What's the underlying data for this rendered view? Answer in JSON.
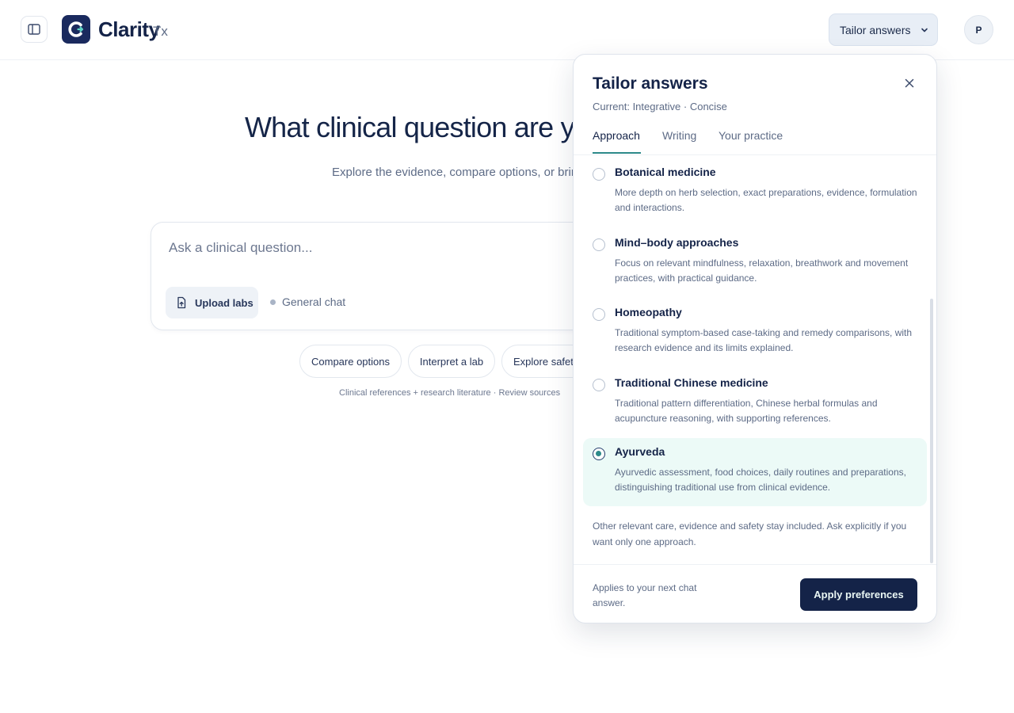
{
  "app": {
    "brand": "Clarity",
    "brand_suffix": "Tx"
  },
  "header": {
    "tailor_label": "Tailor answers",
    "avatar_initial": "P"
  },
  "main": {
    "headline": "What clinical question are yo",
    "subtitle": "Explore the evidence, compare options, or brin",
    "ask_placeholder": "Ask a clinical question...",
    "upload_label": "Upload labs",
    "mode_label": "General chat",
    "chips": [
      "Compare options",
      "Interpret a lab",
      "Explore safet"
    ],
    "footnote": "Clinical references + research literature · Review sources"
  },
  "popover": {
    "title": "Tailor answers",
    "current": "Current: Integrative · Concise",
    "tabs": [
      "Approach",
      "Writing",
      "Your practice"
    ],
    "active_tab": "Approach",
    "options": [
      {
        "title": "Botanical medicine",
        "desc": "More depth on herb selection, exact preparations, evidence, formulation and interactions.",
        "selected": false
      },
      {
        "title": "Mind–body approaches",
        "desc": "Focus on relevant mindfulness, relaxation, breathwork and movement practices, with practical guidance.",
        "selected": false
      },
      {
        "title": "Homeopathy",
        "desc": "Traditional symptom-based case-taking and remedy comparisons, with research evidence and its limits explained.",
        "selected": false
      },
      {
        "title": "Traditional Chinese medicine",
        "desc": "Traditional pattern differentiation, Chinese herbal formulas and acupuncture reasoning, with supporting references.",
        "selected": false
      },
      {
        "title": "Ayurveda",
        "desc": "Ayurvedic assessment, food choices, daily routines and preparations, distinguishing traditional use from clinical evidence.",
        "selected": true
      }
    ],
    "note": "Other relevant care, evidence and safety stay included. Ask explicitly if you want only one approach.",
    "applies_text": "Applies to your next chat answer.",
    "apply_label": "Apply preferences"
  },
  "colors": {
    "brand_navy": "#142348",
    "accent_teal": "#2d8a8a",
    "selected_bg": "#ecfaf7"
  }
}
